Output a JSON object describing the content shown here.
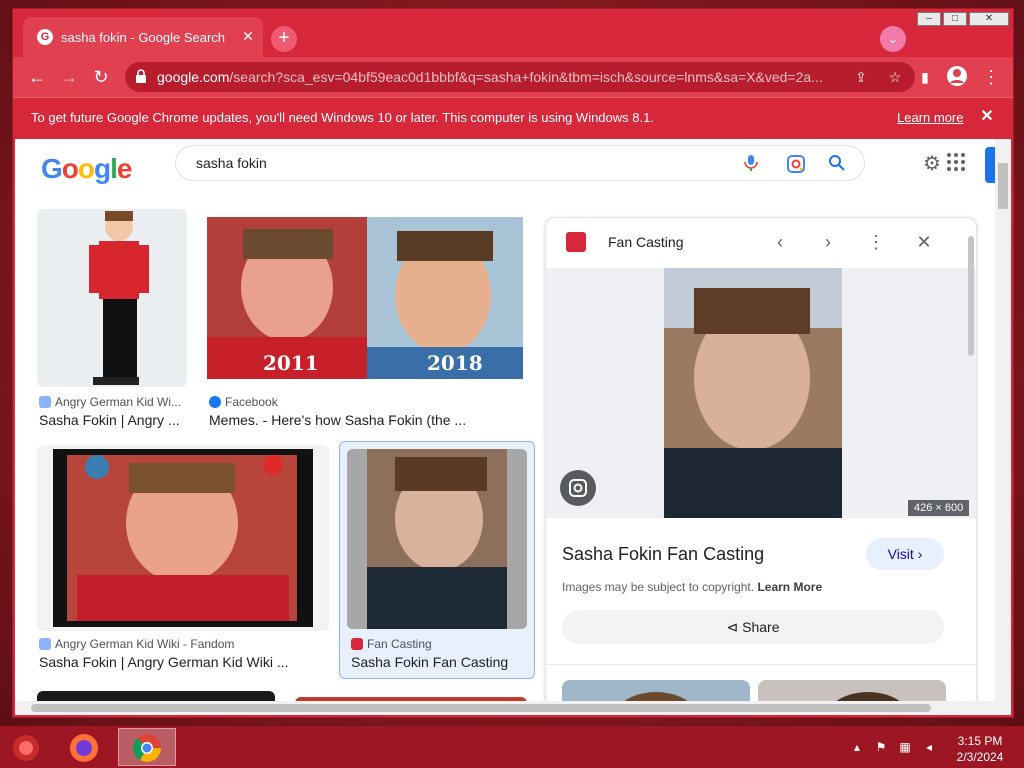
{
  "browser": {
    "tab_title": "sasha fokin - Google Search",
    "url_host": "google.com",
    "url_rest": "/search?sca_esv=04bf59eac0d1bbbf&q=sasha+fokin&tbm=isch&source=lnms&sa=X&ved=2a...",
    "window_controls": [
      "minimize",
      "maximize",
      "close"
    ]
  },
  "infobar": {
    "message": "To get future Google Chrome updates, you'll need Windows 10 or later. This computer is using Windows 8.1.",
    "learn_more": "Learn more"
  },
  "search": {
    "logo_letters": [
      {
        "char": "G",
        "color": "#4285F4"
      },
      {
        "char": "o",
        "color": "#EA4335"
      },
      {
        "char": "o",
        "color": "#FBBC05"
      },
      {
        "char": "g",
        "color": "#4285F4"
      },
      {
        "char": "l",
        "color": "#34A853"
      },
      {
        "char": "e",
        "color": "#EA4335"
      }
    ],
    "query": "sasha fokin"
  },
  "results": [
    {
      "source": "Angry German Kid Wi...",
      "title": "Sasha Fokin | Angry ...",
      "source_icon_color": "#8ab4f8"
    },
    {
      "source": "Facebook",
      "title": "Memes. - Here's how Sasha Fokin (the ...",
      "source_icon_color": "#1877f2",
      "overlay_left": "2011",
      "overlay_right": "2018"
    },
    {
      "source": "Angry German Kid Wiki - Fandom",
      "title": "Sasha Fokin | Angry German Kid Wiki ...",
      "source_icon_color": "#8ab4f8"
    },
    {
      "source": "Fan Casting",
      "title": "Sasha Fokin Fan Casting",
      "source_icon_color": "#d6283a"
    }
  ],
  "panel": {
    "site": "Fan Casting",
    "dimensions": "426 × 600",
    "title": "Sasha Fokin Fan Casting",
    "visit_label": "Visit",
    "copyright_text": "Images may be subject to copyright.",
    "copyright_link": "Learn More",
    "share_label": "Share"
  },
  "taskbar": {
    "time": "3:15 PM",
    "date": "2/3/2024",
    "apps": [
      "firefox-icon",
      "chrome-icon"
    ]
  }
}
